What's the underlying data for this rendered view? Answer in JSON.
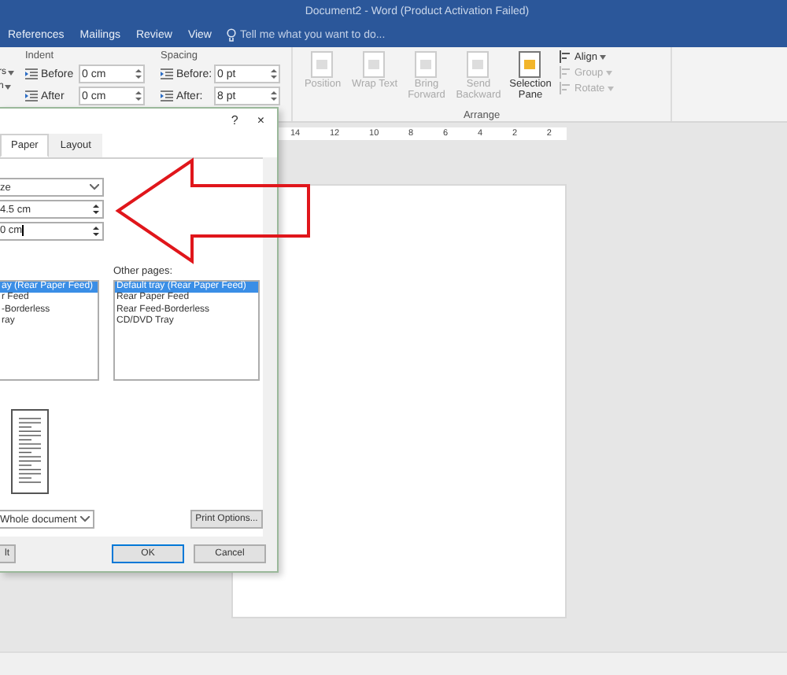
{
  "window": {
    "title": "Document2 - Word (Product Activation Failed)"
  },
  "ribbon_tabs": [
    {
      "label": "References",
      "selected": false
    },
    {
      "label": "Mailings",
      "selected": false
    },
    {
      "label": "Review",
      "selected": false
    },
    {
      "label": "View",
      "selected": false
    }
  ],
  "tell_me": {
    "placeholder": "Tell me what you want to do..."
  },
  "ribbon": {
    "cut_buttons": [
      "rs",
      "n"
    ],
    "indent": {
      "label": "Indent",
      "rows": [
        {
          "label": "Before",
          "value": "0 cm"
        },
        {
          "label": "After",
          "value": "0 cm"
        }
      ]
    },
    "spacing": {
      "label": "Spacing",
      "rows": [
        {
          "label": "Before:",
          "value": "0 pt"
        },
        {
          "label": "After:",
          "value": "8 pt"
        }
      ]
    },
    "arrange_buttons": [
      {
        "label": "Position",
        "disabled": true
      },
      {
        "label": "Wrap Text",
        "disabled": true
      },
      {
        "label": "Bring Forward",
        "disabled": true
      },
      {
        "label": "Send Backward",
        "disabled": true
      },
      {
        "label": "Selection Pane",
        "disabled": false
      }
    ],
    "arrange_small": [
      {
        "label": "Align",
        "disabled": false
      },
      {
        "label": "Group",
        "disabled": true
      },
      {
        "label": "Rotate",
        "disabled": true
      }
    ],
    "group_label": "Arrange"
  },
  "ruler": {
    "ticks": [
      "14",
      "12",
      "10",
      "8",
      "6",
      "4",
      "2",
      "2"
    ]
  },
  "dialog": {
    "help": "?",
    "close": "×",
    "tabs": [
      {
        "label": "Paper",
        "selected": true
      },
      {
        "label": "Layout",
        "selected": false
      }
    ],
    "paper_size": "ze",
    "width": "4.5 cm",
    "height": "0 cm",
    "first_page": [
      {
        "label": "ay (Rear Paper Feed)",
        "selected": true
      },
      {
        "label": "r Feed",
        "selected": false
      },
      {
        "label": "-Borderless",
        "selected": false
      },
      {
        "label": "ray",
        "selected": false
      }
    ],
    "other_pages": {
      "label": "Other pages:",
      "items": [
        {
          "label": "Default tray (Rear Paper Feed)",
          "selected": true
        },
        {
          "label": "Rear Paper Feed",
          "selected": false
        },
        {
          "label": "Rear Feed-Borderless",
          "selected": false
        },
        {
          "label": "CD/DVD Tray",
          "selected": false
        }
      ]
    },
    "apply_to": "Whole document",
    "print_options": "Print Options...",
    "buttons": [
      {
        "label": "lt",
        "default": false
      },
      {
        "label": "OK",
        "default": true
      },
      {
        "label": "Cancel",
        "default": false
      }
    ]
  }
}
